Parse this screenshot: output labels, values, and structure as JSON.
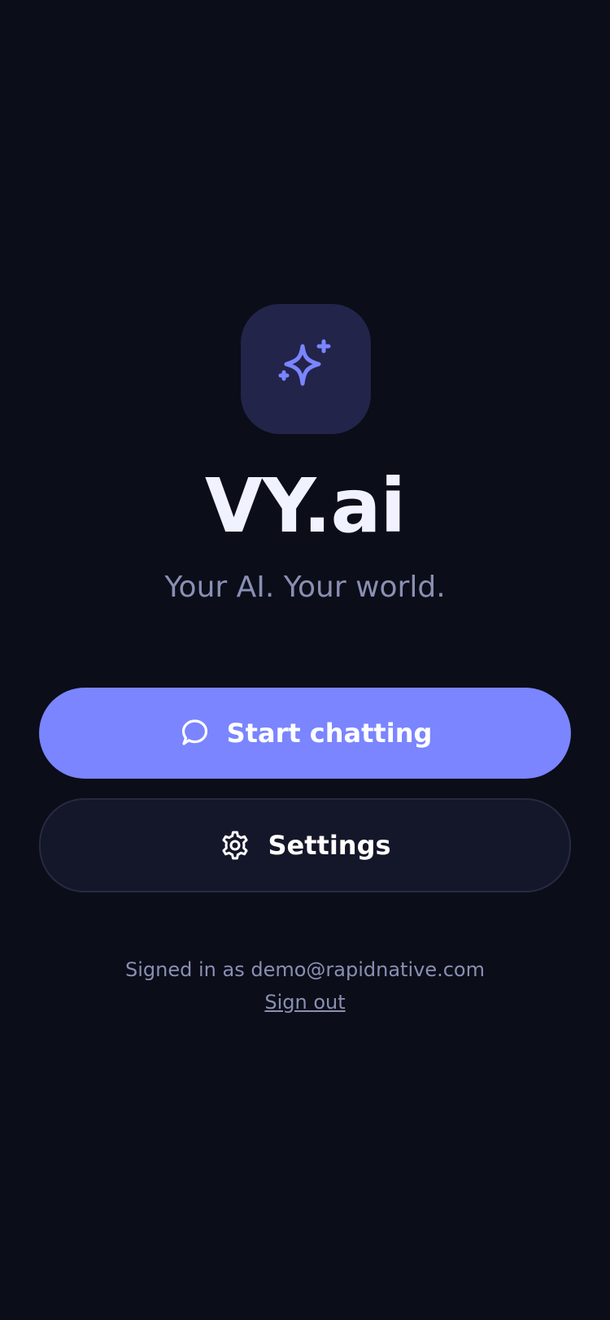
{
  "app": {
    "title": "VY.ai",
    "tagline": "Your AI. Your world.",
    "logo_icon": "sparkles-icon"
  },
  "actions": {
    "start_chatting": {
      "label": "Start chatting",
      "icon": "chat-bubble-icon"
    },
    "settings": {
      "label": "Settings",
      "icon": "gear-icon"
    }
  },
  "account": {
    "signed_in_text": "Signed in as demo@rapidnative.com",
    "sign_out_label": "Sign out"
  },
  "colors": {
    "background": "#0b0d18",
    "accent": "#7a85ff",
    "icon_tile": "#22244a",
    "secondary_button": "#141729",
    "muted_text": "#8a8fb3"
  }
}
